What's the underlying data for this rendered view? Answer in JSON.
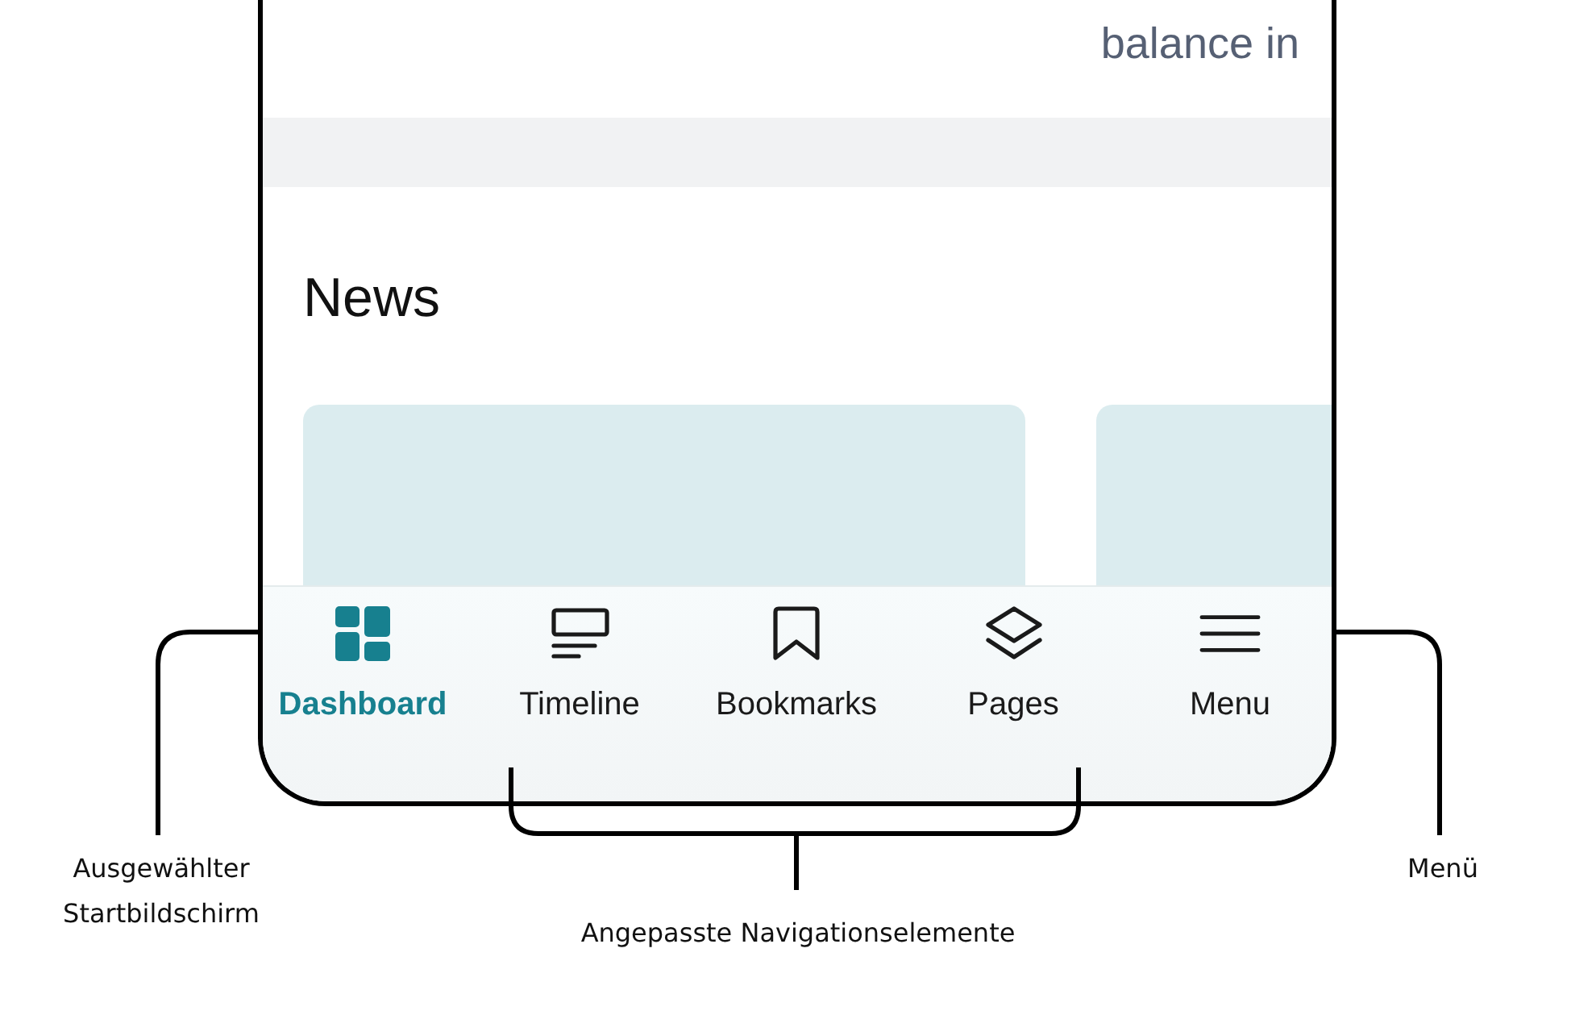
{
  "screen": {
    "intro_text": "balance in",
    "section_title": "News"
  },
  "bottom_nav": [
    {
      "label": "Dashboard",
      "selected": true
    },
    {
      "label": "Timeline",
      "selected": false
    },
    {
      "label": "Bookmarks",
      "selected": false
    },
    {
      "label": "Pages",
      "selected": false
    },
    {
      "label": "Menu",
      "selected": false
    }
  ],
  "annotations": [
    {
      "text": "Ausgewählter Startbildschirm"
    },
    {
      "text": "Angepasste Navigationselemente"
    },
    {
      "text": "Menü"
    }
  ]
}
